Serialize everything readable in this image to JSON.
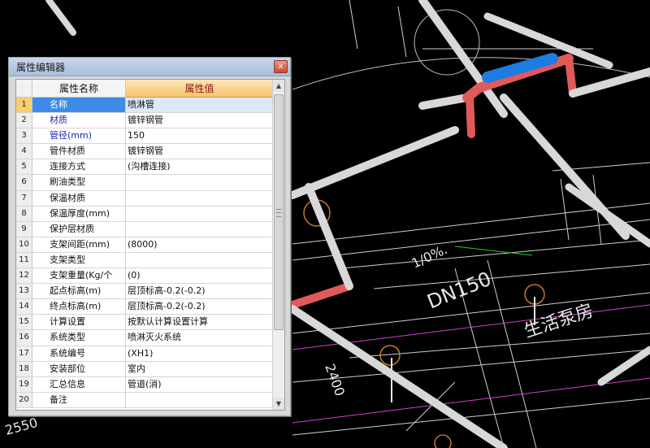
{
  "window": {
    "title": "属性编辑器",
    "close_glyph": "x"
  },
  "grid": {
    "header_name": "属性名称",
    "header_value": "属性值",
    "rows": [
      {
        "num": "1",
        "name": "名称",
        "value": "喷淋管"
      },
      {
        "num": "2",
        "name": "材质",
        "value": "镀锌钢管"
      },
      {
        "num": "3",
        "name": "管径(mm)",
        "value": "150"
      },
      {
        "num": "4",
        "name": "管件材质",
        "value": "镀锌钢管"
      },
      {
        "num": "5",
        "name": "连接方式",
        "value": "(沟槽连接)"
      },
      {
        "num": "6",
        "name": "刷油类型",
        "value": ""
      },
      {
        "num": "7",
        "name": "保温材质",
        "value": ""
      },
      {
        "num": "8",
        "name": "保温厚度(mm)",
        "value": ""
      },
      {
        "num": "9",
        "name": "保护层材质",
        "value": ""
      },
      {
        "num": "10",
        "name": "支架间距(mm)",
        "value": "(8000)"
      },
      {
        "num": "11",
        "name": "支架类型",
        "value": ""
      },
      {
        "num": "12",
        "name": "支架重量(Kg/个",
        "value": "(0)"
      },
      {
        "num": "13",
        "name": "起点标高(m)",
        "value": "层顶标高-0.2(-0.2)"
      },
      {
        "num": "14",
        "name": "终点标高(m)",
        "value": "层顶标高-0.2(-0.2)"
      },
      {
        "num": "15",
        "name": "计算设置",
        "value": "按默认计算设置计算"
      },
      {
        "num": "16",
        "name": "系统类型",
        "value": "喷淋灭火系统"
      },
      {
        "num": "17",
        "name": "系统编号",
        "value": "(XH1)"
      },
      {
        "num": "18",
        "name": "安装部位",
        "value": "室内"
      },
      {
        "num": "19",
        "name": "汇总信息",
        "value": "管道(消)"
      },
      {
        "num": "20",
        "name": "备注",
        "value": ""
      }
    ]
  },
  "cad": {
    "labels": {
      "pipe_size": "DN150",
      "room_name": "生活泵房",
      "dim_2400": "2400",
      "dim_2550": "2550",
      "slope_text": "1/0%."
    },
    "colors": {
      "pipe": "#d8d8d8",
      "pipe_fitting": "#e05a5a",
      "pipe_selected": "#1e7be0",
      "dim_line": "#d63fd6",
      "marker": "#e08a2a",
      "accent_green": "#22cc22"
    }
  }
}
